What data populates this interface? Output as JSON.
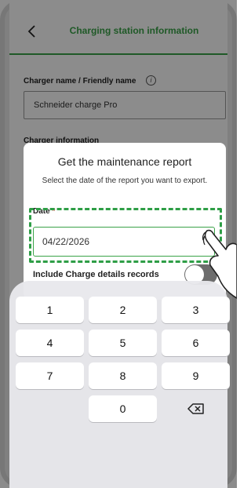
{
  "header": {
    "title": "Charging station information"
  },
  "form": {
    "charger_name_label": "Charger name / Friendly name",
    "charger_name_value": "Schneider charge Pro",
    "charger_info_label": "Charger information"
  },
  "modal": {
    "title": "Get the maintenance report",
    "subtitle": "Select the date of the report you want to export.",
    "date_label": "Date",
    "date_required_mark": "*",
    "date_value": "04/22/2026",
    "toggle_label": "Include Charge details records",
    "toggle_on": false
  },
  "keypad": {
    "keys": [
      "1",
      "2",
      "3",
      "4",
      "5",
      "6",
      "7",
      "8",
      "9",
      "0"
    ]
  },
  "colors": {
    "accent": "#3aa348",
    "required": "#e01b1b",
    "highlight": "#2e9e46"
  }
}
